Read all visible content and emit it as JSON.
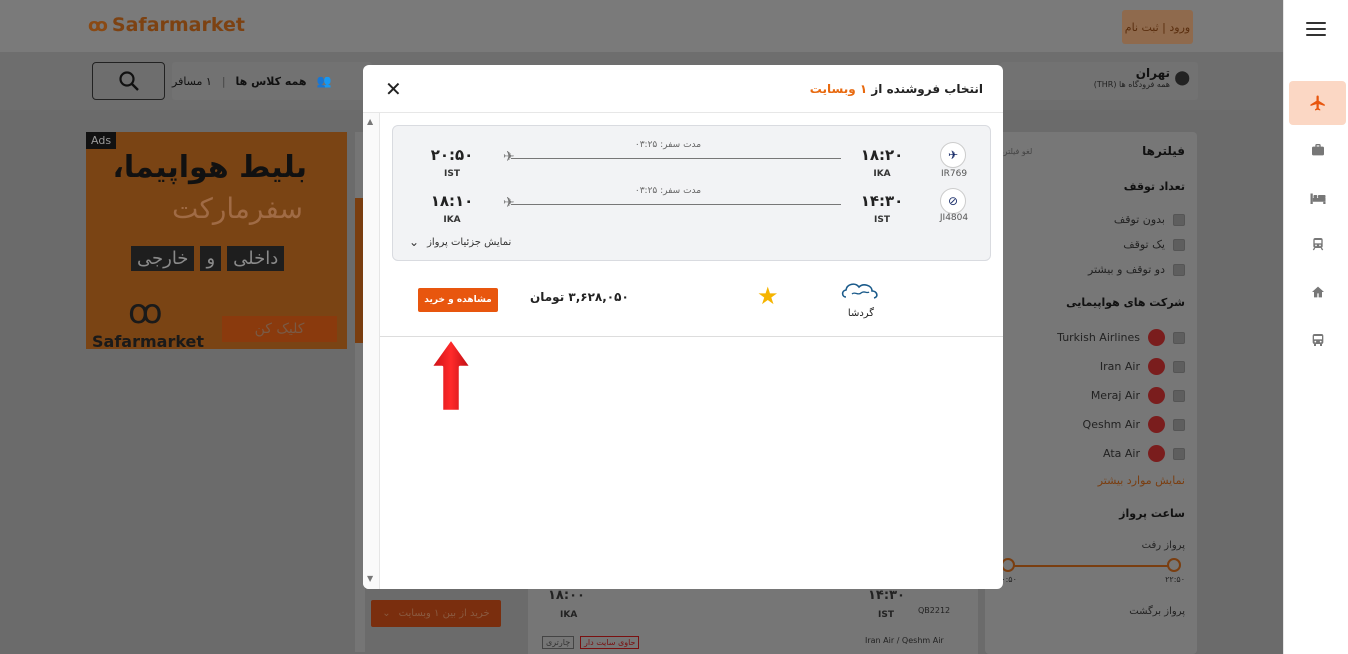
{
  "header": {
    "logo_text": "Safarmarket",
    "login_label": "ورود | ثبت نام"
  },
  "search": {
    "origin_city": "تهران",
    "origin_sub": "همه فرودگاه ها (THR)",
    "class_label": "همه کلاس ها",
    "passengers_label": "۱ مسافر"
  },
  "ad": {
    "badge": "Ads",
    "line1": "بلیط هواپیما،",
    "line2": "سفرمارکت",
    "words": [
      "داخلی",
      "و",
      "خارجی"
    ],
    "brand": "Safarmarket",
    "cta": "کلیک کن"
  },
  "filters": {
    "title": "فیلترها",
    "clear": "لغو فیلترها",
    "stops_title": "تعداد توقف",
    "stops": [
      "بدون توقف",
      "یک توقف",
      "دو توقف و بیشتر"
    ],
    "airlines_title": "شرکت های هواپیمایی",
    "airlines": [
      "Turkish Airlines",
      "Iran Air",
      "Meraj Air",
      "Qeshm Air",
      "Ata Air"
    ],
    "more_label": "نمایش موارد بیشتر",
    "time_title": "ساعت پرواز",
    "departure_label": "پرواز رفت",
    "range_min": "۰۰:۵۰",
    "range_max": "۲۲:۵۰",
    "return_label": "پرواز برگشت"
  },
  "behind": {
    "buy_from": "خرید از بین ۱ وبسایت",
    "dep_time": "۱۴:۳۰",
    "arr_time": "۱۸:۰۰",
    "dep_ap": "IST",
    "arr_ap": "IKA",
    "code": "QB2212",
    "airlines": "Iran Air / Qeshm Air",
    "tag_site": "حاوی سایت دار",
    "tag_charter": "چارتری"
  },
  "modal": {
    "title_prefix": "انتخاب فروشنده از",
    "title_count": "۱ وبسایت",
    "legs": [
      {
        "code": "IR769",
        "dep_time": "۱۸:۲۰",
        "dep_ap": "IKA",
        "arr_time": "۲۰:۵۰",
        "arr_ap": "IST",
        "duration": "مدت سفر: ۰۳:۲۵"
      },
      {
        "code": "JI4804",
        "dep_time": "۱۴:۳۰",
        "dep_ap": "IST",
        "arr_time": "۱۸:۱۰",
        "arr_ap": "IKA",
        "duration": "مدت سفر: ۰۳:۲۵"
      }
    ],
    "details_label": "نمایش جزئیات پرواز",
    "offer": {
      "vendor": "گردشا",
      "vendor_logo_text": "گردشا",
      "price": "۳,۶۲۸,۰۵۰ تومان",
      "buy_label": "مشاهده و خرید"
    }
  },
  "colors": {
    "accent": "#e8560e",
    "highlight": "#e86a10",
    "star": "#f5b400",
    "arrow": "#e3151e"
  },
  "icons": {
    "close": "close-icon",
    "search": "search-icon",
    "plane": "plane-icon",
    "star": "star-icon"
  }
}
